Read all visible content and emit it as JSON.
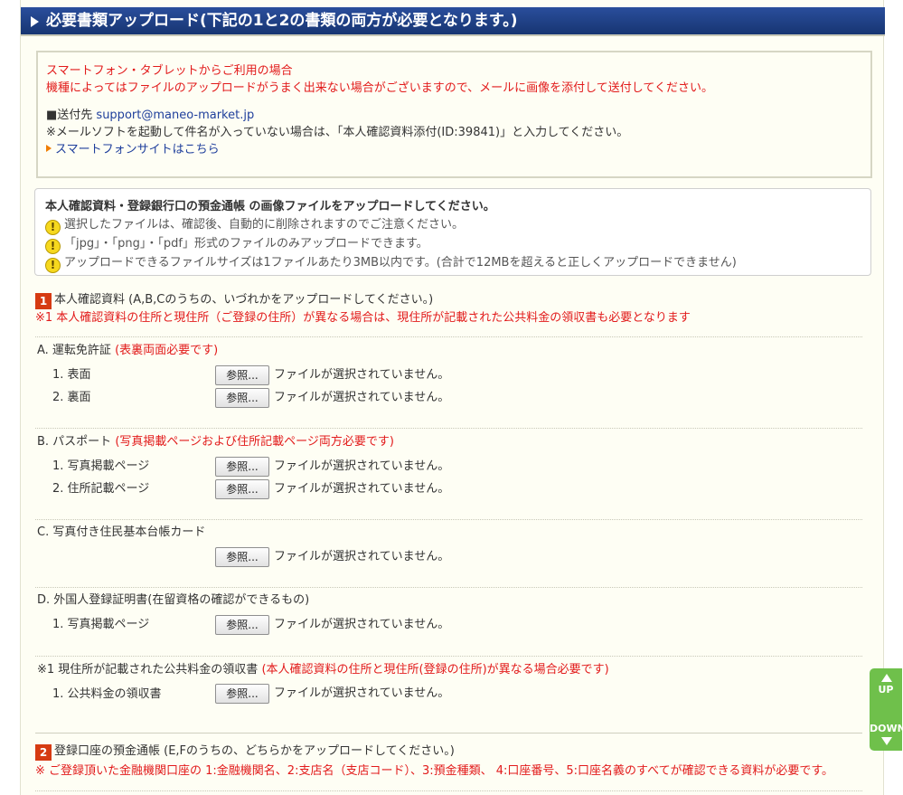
{
  "header": {
    "title": "必要書類アップロード(下記の1と2の書類の両方が必要となります。)"
  },
  "notice": {
    "line1": "スマートフォン・タブレットからご利用の場合",
    "line2": "機種によってはファイルのアップロードがうまく出来ない場合がございますので、メールに画像を添付して送付してください。",
    "send_label": "■送付先 ",
    "email": "support@maneo-market.jp",
    "subject_note": "※メールソフトを起動して件名が入っていない場合は、「本人確認資料添付(ID:39841)」と入力してください。",
    "smartphone_link": "スマートフォンサイトはこちら"
  },
  "upload_box": {
    "title": "本人確認資料・登録銀行口の預金通帳 の画像ファイルをアップロードしてください。",
    "warnings": [
      "選択したファイルは、確認後、自動的に削除されますのでご注意ください。",
      "「jpg」・「png」・「pdf」形式のファイルのみアップロードできます。",
      "アップロードできるファイルサイズは1ファイルあたり3MB以内です。(合計で12MBを超えると正しくアップロードできません)"
    ]
  },
  "section1": {
    "number": "1",
    "title": "本人確認資料 (A,B,Cのうちの、いづれかをアップロードしてください。)",
    "note": "※1 本人確認資料の住所と現住所（ご登録の住所）が異なる場合は、現住所が記載された公共料金の領収書も必要となります"
  },
  "docA": {
    "title": "A. 運転免許証 ",
    "note": "(表裏両面必要です)",
    "items": [
      "1. 表面",
      "2. 裏面"
    ]
  },
  "docB": {
    "title": "B. パスポート ",
    "note": "(写真掲載ページおよび住所記載ページ両方必要です)",
    "items": [
      "1. 写真掲載ページ",
      "2. 住所記載ページ"
    ]
  },
  "docC": {
    "title": "C. 写真付き住民基本台帳カード"
  },
  "docD": {
    "title": "D. 外国人登録証明書(在留資格の確認ができるもの)",
    "items": [
      "1. 写真掲載ページ"
    ]
  },
  "docUtility": {
    "title": "※1 現住所が記載された公共料金の領収書 ",
    "note": "(本人確認資料の住所と現住所(登録の住所)が異なる場合必要です)",
    "items": [
      "1. 公共料金の領収書"
    ]
  },
  "section2": {
    "number": "2",
    "title": "登録口座の預金通帳 (E,Fのうちの、どちらかをアップロードしてください。)",
    "note": "※ ご登録頂いた金融機関口座の 1:金融機関名、2:支店名（支店コード）、3:預金種類、 4:口座番号、5:口座名義のすべてが確認できる資料が必要です。"
  },
  "file_input": {
    "browse_label": "参照...",
    "no_file_text": "ファイルが選択されていません。"
  },
  "scroll_nav": {
    "up": "UP",
    "down": "DOWN"
  },
  "colors": {
    "header_bg": "#1f3f86",
    "accent_red": "#e21b1b",
    "link_blue": "#1f3f9c",
    "badge": "#d63b12",
    "scroll_green": "#6fc04b"
  }
}
